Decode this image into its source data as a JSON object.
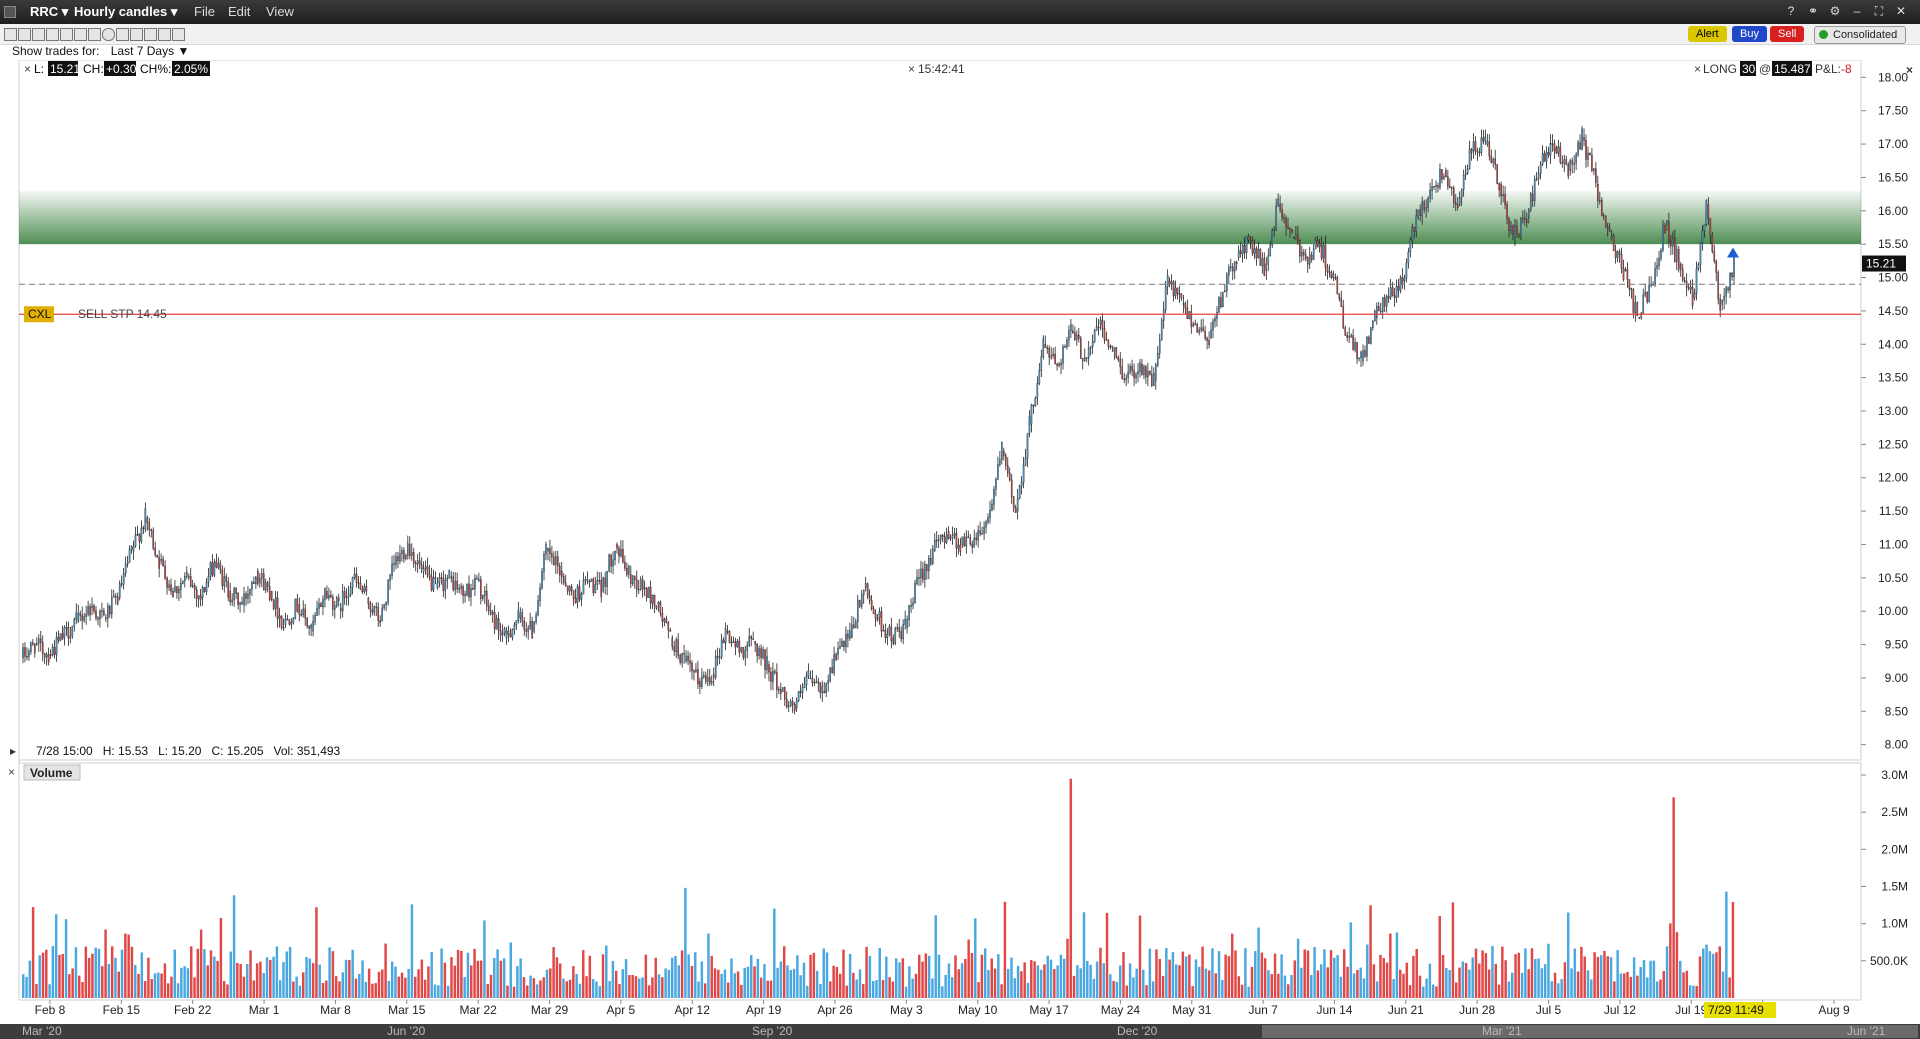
{
  "window": {
    "symbol": "RRC",
    "period": "Hourly candles",
    "menu": [
      "File",
      "Edit",
      "View"
    ]
  },
  "toolbar": {
    "alert_label": "Alert",
    "buy_label": "Buy",
    "sell_label": "Sell",
    "consolidated_label": "Consolidated",
    "show_trades_label": "Show trades for:",
    "show_trades_value": "Last 7 Days"
  },
  "quote": {
    "last_label": "L:",
    "last": "15.21",
    "change_label": "CH:",
    "change": "+0.30",
    "change_pct_label": "CH%:",
    "change_pct": "2.05%",
    "time": "15:42:41",
    "position_label": "LONG",
    "position_qty": "30",
    "at": "@",
    "avg_price": "15.487",
    "pnl_label": "P&L:",
    "pnl": "-8"
  },
  "order": {
    "cancel_label": "CXL",
    "text": "SELL STP 14.45",
    "price": 14.45
  },
  "bar_info": "7/28 15:00   H: 15.53   L: 15.20   C: 15.205   Vol: 351,493",
  "volume_label": "Volume",
  "current_time_label": "7/29 11:49",
  "colors": {
    "up": "#4aa8e0",
    "down": "#e04848",
    "order_line": "#e04040",
    "zone": "#2f7a34",
    "price_tag": "#111111",
    "title_bg": "#2a2a2a"
  },
  "chart_data": {
    "type": "candlestick",
    "price_axis": {
      "ylim": [
        7.8,
        18.2
      ],
      "ticks": [
        "8.00",
        "8.50",
        "9.00",
        "9.50",
        "10.00",
        "10.50",
        "11.00",
        "11.50",
        "12.00",
        "12.50",
        "13.00",
        "13.50",
        "14.00",
        "14.50",
        "15.00",
        "15.50",
        "16.00",
        "16.50",
        "17.00",
        "17.50",
        "18.00"
      ]
    },
    "volume_axis": {
      "ylim": [
        0,
        3000000
      ],
      "ticks": [
        "500.0K",
        "1.0M",
        "1.5M",
        "2.0M",
        "2.5M",
        "3.0M"
      ]
    },
    "x_ticks": [
      "Feb 8",
      "Feb 15",
      "Feb 22",
      "Mar 1",
      "Mar 8",
      "Mar 15",
      "Mar 22",
      "Mar 29",
      "Apr 5",
      "Apr 12",
      "Apr 19",
      "Apr 26",
      "May 3",
      "May 10",
      "May 17",
      "May 24",
      "May 31",
      "Jun 7",
      "Jun 14",
      "Jun 21",
      "Jun 28",
      "Jul 5",
      "Jul 12",
      "Jul 19",
      "Jul 2",
      "Aug 9"
    ],
    "navigator_ticks": [
      "Mar '20",
      "Jun '20",
      "Sep '20",
      "Dec '20",
      "Mar '21",
      "Jun '21"
    ],
    "last_price": 15.21,
    "avg_cost": 14.9,
    "daily_series": [
      [
        "Feb 4",
        9.3,
        9.5
      ],
      [
        "Feb 5",
        9.5,
        9.35
      ],
      [
        "Feb 8",
        9.35,
        9.6
      ],
      [
        "Feb 9",
        9.6,
        9.85
      ],
      [
        "Feb 10",
        9.85,
        10.05
      ],
      [
        "Feb 11",
        10.05,
        9.9
      ],
      [
        "Feb 12",
        9.9,
        10.2
      ],
      [
        "Feb 15",
        10.2,
        10.9
      ],
      [
        "Feb 16",
        10.9,
        11.4
      ],
      [
        "Feb 17",
        11.4,
        10.75
      ],
      [
        "Feb 18",
        10.75,
        10.3
      ],
      [
        "Feb 19",
        10.3,
        10.5
      ],
      [
        "Feb 22",
        10.5,
        10.2
      ],
      [
        "Feb 23",
        10.2,
        10.75
      ],
      [
        "Feb 24",
        10.75,
        10.3
      ],
      [
        "Feb 25",
        10.3,
        10.1
      ],
      [
        "Feb 26",
        10.1,
        10.6
      ],
      [
        "Mar 1",
        10.6,
        10.3
      ],
      [
        "Mar 2",
        10.3,
        9.8
      ],
      [
        "Mar 3",
        9.8,
        10.1
      ],
      [
        "Mar 4",
        10.1,
        9.7
      ],
      [
        "Mar 5",
        9.7,
        10.3
      ],
      [
        "Mar 8",
        10.3,
        10.05
      ],
      [
        "Mar 9",
        10.05,
        10.5
      ],
      [
        "Mar 10",
        10.5,
        10.2
      ],
      [
        "Mar 11",
        10.2,
        9.85
      ],
      [
        "Mar 12",
        9.85,
        10.7
      ],
      [
        "Mar 15",
        10.7,
        11.0
      ],
      [
        "Mar 16",
        11.0,
        10.6
      ],
      [
        "Mar 17",
        10.6,
        10.35
      ],
      [
        "Mar 18",
        10.35,
        10.5
      ],
      [
        "Mar 19",
        10.5,
        10.25
      ],
      [
        "Mar 22",
        10.25,
        10.45
      ],
      [
        "Mar 23",
        10.45,
        9.95
      ],
      [
        "Mar 24",
        9.95,
        9.6
      ],
      [
        "Mar 25",
        9.6,
        9.9
      ],
      [
        "Mar 26",
        9.9,
        9.7
      ],
      [
        "Mar 29",
        9.7,
        10.9
      ],
      [
        "Mar 30",
        10.9,
        10.6
      ],
      [
        "Mar 31",
        10.6,
        10.2
      ],
      [
        "Apr 1",
        10.2,
        10.45
      ],
      [
        "Apr 2",
        10.45,
        10.3
      ],
      [
        "Apr 5",
        10.3,
        11.0
      ],
      [
        "Apr 6",
        11.0,
        10.55
      ],
      [
        "Apr 7",
        10.55,
        10.35
      ],
      [
        "Apr 8",
        10.35,
        10.1
      ],
      [
        "Apr 9",
        10.1,
        9.6
      ],
      [
        "Apr 12",
        9.6,
        9.25
      ],
      [
        "Apr 13",
        9.25,
        8.95
      ],
      [
        "Apr 14",
        8.95,
        9.05
      ],
      [
        "Apr 15",
        9.05,
        9.7
      ],
      [
        "Apr 16",
        9.7,
        9.4
      ],
      [
        "Apr 19",
        9.4,
        9.55
      ],
      [
        "Apr 20",
        9.55,
        9.2
      ],
      [
        "Apr 21",
        9.2,
        8.8
      ],
      [
        "Apr 22",
        8.8,
        8.55
      ],
      [
        "Apr 23",
        8.55,
        9.0
      ],
      [
        "Apr 26",
        9.0,
        8.8
      ],
      [
        "Apr 27",
        8.8,
        9.35
      ],
      [
        "Apr 28",
        9.35,
        9.6
      ],
      [
        "Apr 29",
        9.6,
        10.35
      ],
      [
        "Apr 30",
        10.35,
        9.9
      ],
      [
        "May 3",
        9.9,
        9.6
      ],
      [
        "May 4",
        9.6,
        9.75
      ],
      [
        "May 5",
        9.75,
        10.5
      ],
      [
        "May 6",
        10.5,
        10.9
      ],
      [
        "May 7",
        10.9,
        11.2
      ],
      [
        "May 10",
        11.2,
        11.0
      ],
      [
        "May 11",
        11.0,
        11.1
      ],
      [
        "May 12",
        11.1,
        11.4
      ],
      [
        "May 13",
        11.4,
        12.4
      ],
      [
        "May 14",
        12.4,
        11.5
      ],
      [
        "May 17",
        11.5,
        12.8
      ],
      [
        "May 18",
        12.8,
        14.0
      ],
      [
        "May 19",
        14.0,
        13.7
      ],
      [
        "May 20",
        13.7,
        14.2
      ],
      [
        "May 21",
        14.2,
        13.8
      ],
      [
        "May 24",
        13.8,
        14.3
      ],
      [
        "May 25",
        14.3,
        13.9
      ],
      [
        "May 26",
        13.9,
        13.5
      ],
      [
        "May 27",
        13.5,
        13.7
      ],
      [
        "May 28",
        13.7,
        13.45
      ],
      [
        "Jun 1",
        13.45,
        14.95
      ],
      [
        "Jun 2",
        14.95,
        14.6
      ],
      [
        "Jun 3",
        14.6,
        14.3
      ],
      [
        "Jun 4",
        14.3,
        14.1
      ],
      [
        "Jun 7",
        14.1,
        14.8
      ],
      [
        "Jun 8",
        14.8,
        15.3
      ],
      [
        "Jun 9",
        15.3,
        15.55
      ],
      [
        "Jun 10",
        15.55,
        15.1
      ],
      [
        "Jun 11",
        15.1,
        16.1
      ],
      [
        "Jun 14",
        16.1,
        15.6
      ],
      [
        "Jun 15",
        15.6,
        15.3
      ],
      [
        "Jun 16",
        15.3,
        15.5
      ],
      [
        "Jun 17",
        15.5,
        15.0
      ],
      [
        "Jun 18",
        15.0,
        14.1
      ],
      [
        "Jun 21",
        14.1,
        13.75
      ],
      [
        "Jun 22",
        13.75,
        14.4
      ],
      [
        "Jun 23",
        14.4,
        14.7
      ],
      [
        "Jun 24",
        14.7,
        14.95
      ],
      [
        "Jun 25",
        14.95,
        15.9
      ],
      [
        "Jun 28",
        15.9,
        16.3
      ],
      [
        "Jun 29",
        16.3,
        16.6
      ],
      [
        "Jun 30",
        16.6,
        16.1
      ],
      [
        "Jul 1",
        16.1,
        16.9
      ],
      [
        "Jul 2",
        16.9,
        17.0
      ],
      [
        "Jul 6",
        17.0,
        16.4
      ],
      [
        "Jul 7",
        16.4,
        15.6
      ],
      [
        "Jul 8",
        15.6,
        15.9
      ],
      [
        "Jul 9",
        15.9,
        16.7
      ],
      [
        "Jul 12",
        16.7,
        16.95
      ],
      [
        "Jul 13",
        16.95,
        16.6
      ],
      [
        "Jul 14",
        16.6,
        17.1
      ],
      [
        "Jul 15",
        17.1,
        16.4
      ],
      [
        "Jul 16",
        16.4,
        15.6
      ],
      [
        "Jul 19",
        15.6,
        15.1
      ],
      [
        "Jul 20",
        15.1,
        14.4
      ],
      [
        "Jul 21",
        14.4,
        14.9
      ],
      [
        "Jul 22",
        14.9,
        15.8
      ],
      [
        "Jul 23",
        15.8,
        15.2
      ],
      [
        "Jul 26",
        15.2,
        14.7
      ],
      [
        "Jul 27",
        14.7,
        16.1
      ],
      [
        "Jul 28",
        16.1,
        14.6
      ],
      [
        "Jul 29",
        14.6,
        15.21
      ]
    ]
  }
}
